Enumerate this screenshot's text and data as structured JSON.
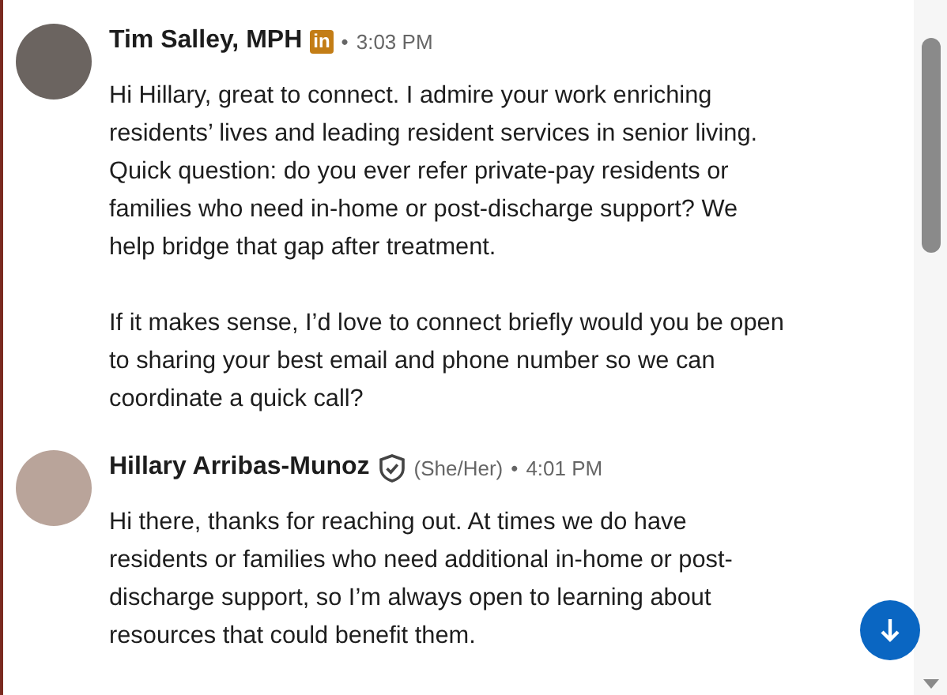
{
  "messages": [
    {
      "sender": "Tim Salley, MPH",
      "badge": {
        "kind": "premium",
        "text": "in"
      },
      "separator": "•",
      "time": "3:03 PM",
      "paragraphs": [
        "Hi Hillary, great to connect. I admire your work enriching residents’ lives and leading resident services in senior living. Quick question: do you ever refer private-pay residents or families who need in-home or post-discharge support? We help bridge that gap after treatment.",
        "If it makes sense, I’d love to connect briefly would you be open to sharing your best email and phone number so we can coordinate a quick call?"
      ]
    },
    {
      "sender": "Hillary Arribas-Munoz",
      "badge": {
        "kind": "verified"
      },
      "pronouns": "(She/Her)",
      "separator": "•",
      "time": "4:01 PM",
      "paragraphs": [
        "Hi there, thanks for reaching out. At times we do have residents or families who need additional in-home or post-discharge support, so I’m always open to learning about resources that could benefit them."
      ]
    }
  ]
}
